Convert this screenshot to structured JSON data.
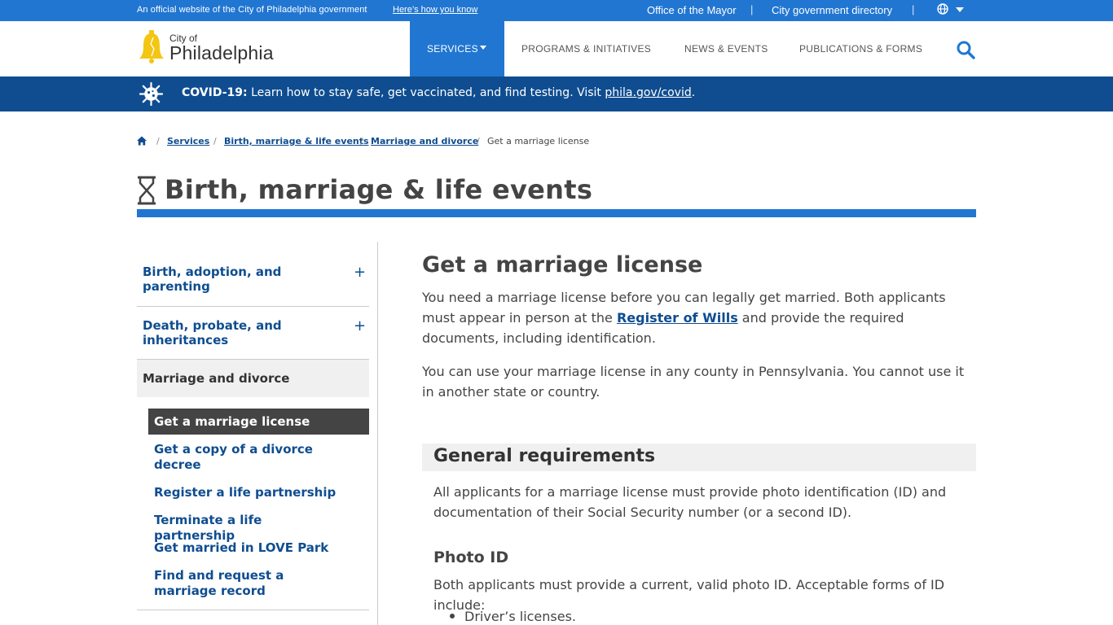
{
  "topbar": {
    "official_text": "An official website of the City of Philadelphia government",
    "official_link": "Here’s how you know",
    "office_link": "Office of the Mayor",
    "directory_link": "City government directory",
    "separator": "|",
    "language_icon": "globe-icon"
  },
  "logo": {
    "city_of": "City of",
    "name": "Philadelphia",
    "icon": "liberty-bell-icon"
  },
  "nav": {
    "services": "SERVICES",
    "programs": "PROGRAMS & INITIATIVES",
    "news": "NEWS & EVENTS",
    "publications": "PUBLICATIONS & FORMS",
    "search_icon": "search-icon"
  },
  "covid": {
    "label": "COVID-19:",
    "message": " Learn how to stay safe, get vaccinated, and find testing. Visit ",
    "link": "phila.gov/covid",
    "period": "."
  },
  "breadcrumb": {
    "home_icon": "home-icon",
    "sep": "/",
    "items": [
      "Services",
      "Birth, marriage & life events",
      "Marriage and divorce"
    ],
    "current": "Get a marriage license"
  },
  "page_title": "Birth, marriage & life events",
  "sidebar": {
    "sections": [
      {
        "label": "Birth, adoption, and parenting",
        "toggle": "+"
      },
      {
        "label": "Death, probate, and inheritances",
        "toggle": "+"
      }
    ],
    "active_section": "Marriage and divorce",
    "sub_items": [
      "Get a marriage license",
      "Get a copy of a divorce decree",
      "Register a life partnership",
      "Terminate a life partnership",
      "Get married in LOVE Park",
      "Find and request a marriage record"
    ]
  },
  "main": {
    "heading": "Get a marriage license",
    "intro_before": "You need a marriage license before you can legally get married. Both applicants must appear in person at the ",
    "intro_link": "Register of Wills",
    "intro_after": " and provide the required documents, including identification.",
    "para2": "You can use your marriage license in any county in Pennsylvania. You cannot use it in another state or country.",
    "section_heading": "General requirements",
    "section_text": "All applicants for a marriage license must provide photo identification (ID) and documentation of their Social Security number (or a second ID).",
    "photo_id_heading": "Photo ID",
    "photo_id_text": "Both applicants must provide a current, valid photo ID. Acceptable forms of ID include:",
    "bullets": [
      "Driver’s licenses."
    ]
  },
  "colors": {
    "brand_blue": "#2176d2",
    "dark_blue": "#0f4d90",
    "logo_yellow": "#f3c613"
  }
}
